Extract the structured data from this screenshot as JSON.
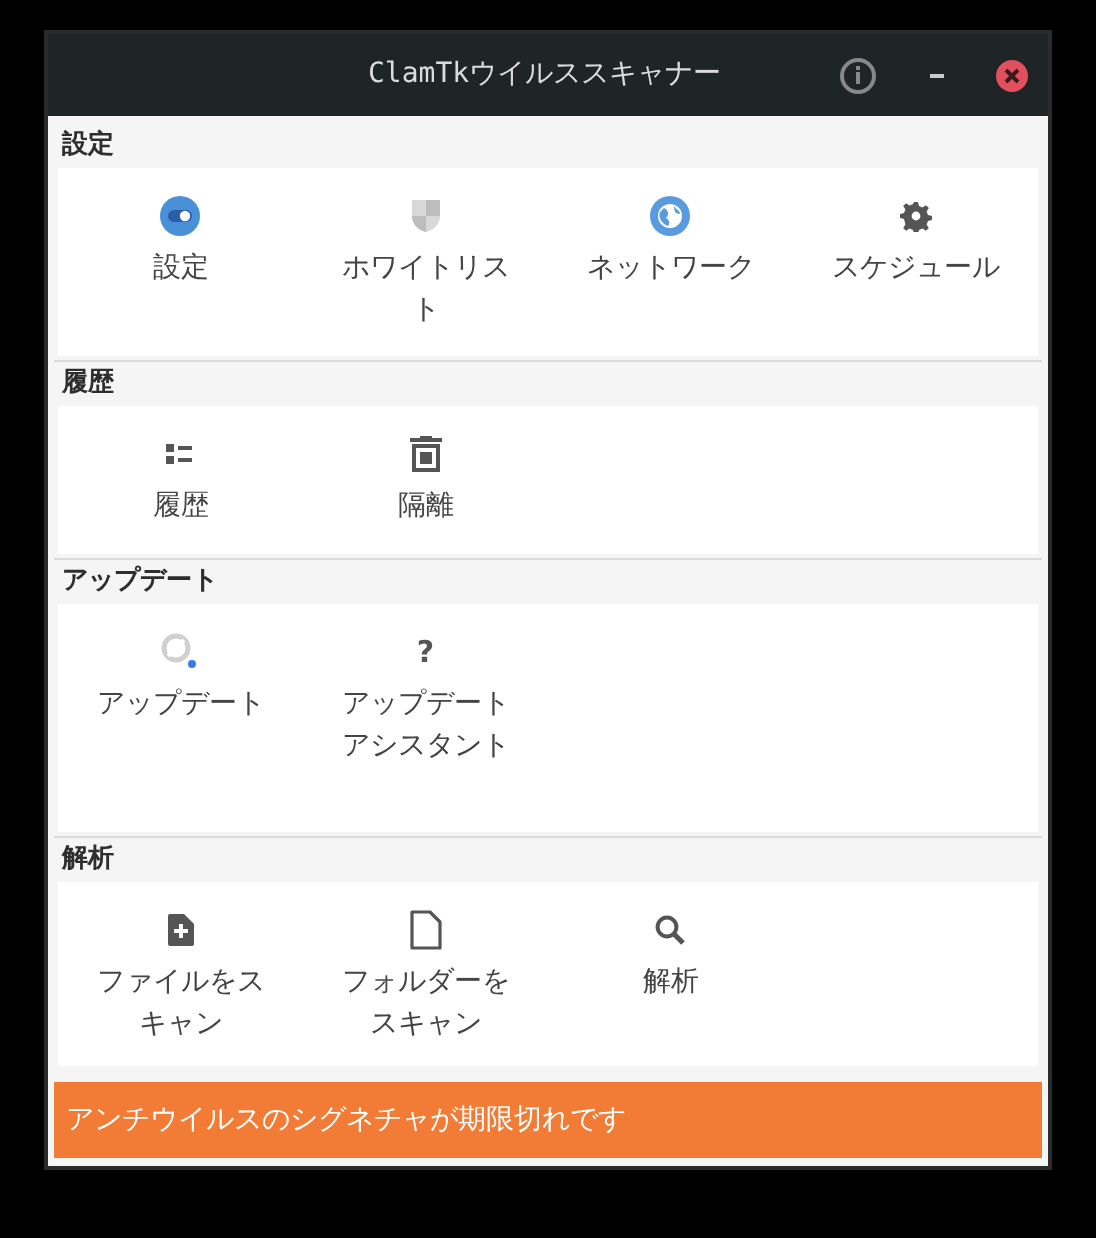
{
  "window": {
    "title": "ClamTkウイルススキャナー"
  },
  "sections": [
    {
      "title": "設定",
      "items": [
        {
          "label": "設定",
          "kind": "settings"
        },
        {
          "label": "ホワイトリスト",
          "kind": "whitelist"
        },
        {
          "label": "ネットワーク",
          "kind": "network"
        },
        {
          "label": "スケジュール",
          "kind": "schedule"
        }
      ]
    },
    {
      "title": "履歴",
      "items": [
        {
          "label": "履歴",
          "kind": "history"
        },
        {
          "label": "隔離",
          "kind": "quarantine"
        }
      ]
    },
    {
      "title": "アップデート",
      "items": [
        {
          "label": "アップデート",
          "kind": "update"
        },
        {
          "label": "アップデートアシスタント",
          "kind": "assistant",
          "icon": "?"
        }
      ]
    },
    {
      "title": "解析",
      "items": [
        {
          "label": "ファイルをスキャン",
          "kind": "scan-file"
        },
        {
          "label": "フォルダーをスキャン",
          "kind": "scan-folder"
        },
        {
          "label": "解析",
          "kind": "analysis"
        }
      ]
    }
  ],
  "status_bar": "アンチウイルスのシグネチャが期限切れです"
}
